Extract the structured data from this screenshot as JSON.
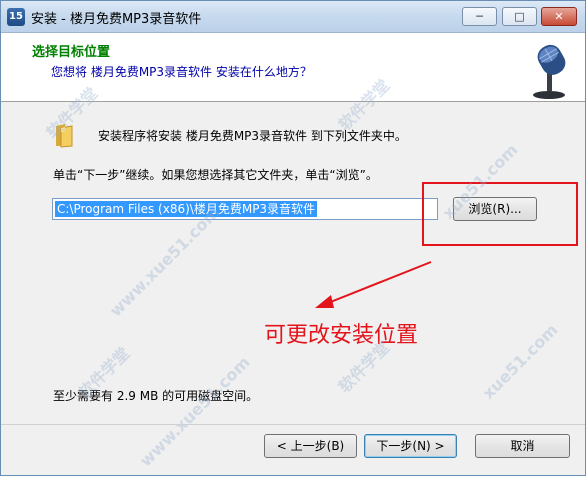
{
  "window": {
    "title": "安装 - 楼月免费MP3录音软件",
    "icon_text": "15"
  },
  "controls": {
    "minimize": "─",
    "maximize": "□",
    "close": "✕"
  },
  "header": {
    "title": "选择目标位置",
    "subtitle": "您想将 楼月免费MP3录音软件 安装在什么地方？"
  },
  "content": {
    "info": "安装程序将安装 楼月免费MP3录音软件 到下列文件夹中。",
    "instruction": "单击“下一步”继续。如果您想选择其它文件夹，单击“浏览”。",
    "path_value": "C:\\Program Files (x86)\\楼月免费MP3录音软件",
    "browse_label": "浏览(R)...",
    "annotation": "可更改安装位置",
    "space_required": "至少需要有 2.9 MB 的可用磁盘空间。"
  },
  "footer": {
    "back_label": "< 上一步(B)",
    "next_label": "下一步(N) >",
    "cancel_label": "取消"
  },
  "colors": {
    "header_title": "#008000",
    "header_subtitle": "#0000aa",
    "annotation": "#e3141b",
    "selection": "#3399ff"
  }
}
